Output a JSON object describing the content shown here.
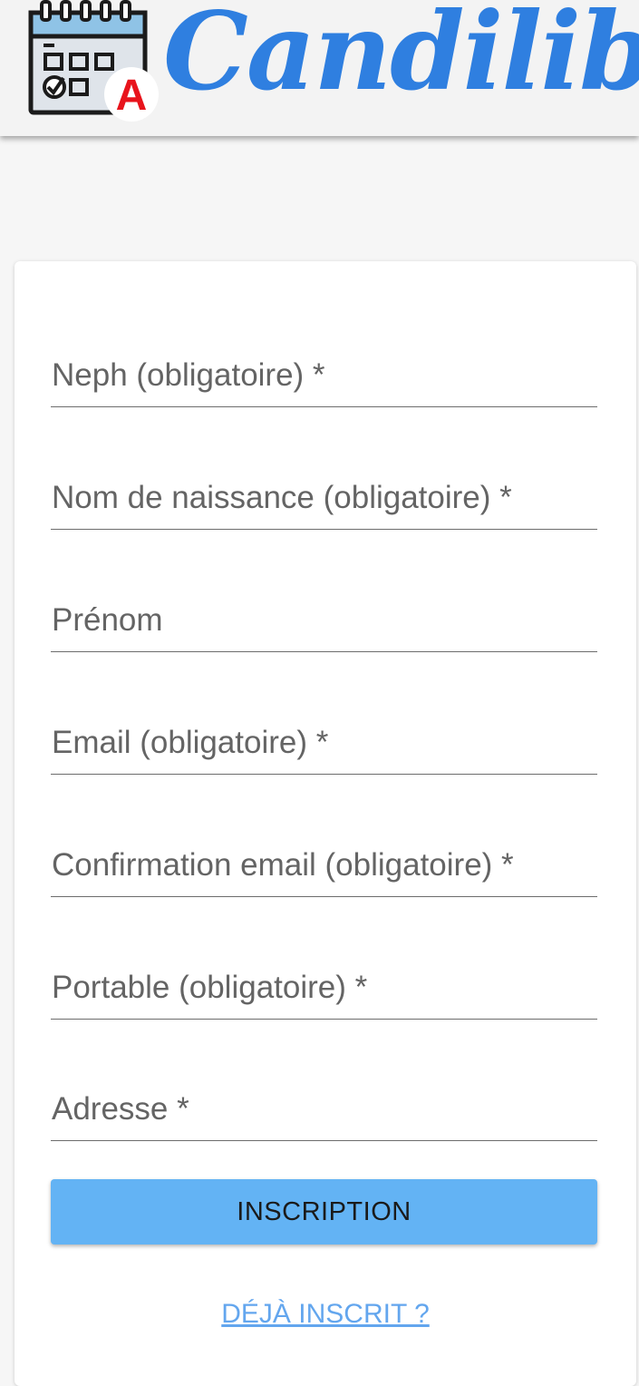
{
  "header": {
    "brand_name": "Candilib",
    "logo_badge_letter": "A",
    "brand_color": "#2f7fe0",
    "badge_color": "#e8141c"
  },
  "form": {
    "fields": [
      {
        "label": "Neph (obligatoire) *"
      },
      {
        "label": "Nom de naissance (obligatoire) *"
      },
      {
        "label": "Prénom"
      },
      {
        "label": "Email (obligatoire) *"
      },
      {
        "label": "Confirmation email (obligatoire) *"
      },
      {
        "label": "Portable (obligatoire) *"
      },
      {
        "label": "Adresse *"
      }
    ],
    "submit_label": "INSCRIPTION",
    "submit_color": "#63b3f4",
    "already_registered_link": "DÉJÀ INSCRIT ?"
  }
}
